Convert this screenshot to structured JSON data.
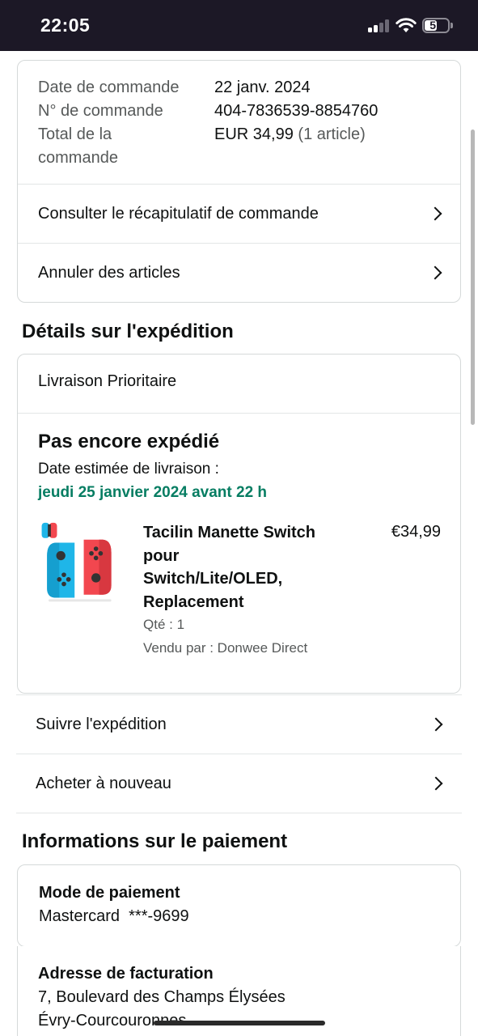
{
  "status_bar": {
    "time": "22:05",
    "battery": "51"
  },
  "order_summary": {
    "rows": [
      {
        "label": "Date de commande",
        "value": "22 janv. 2024"
      },
      {
        "label": "N° de commande",
        "value": "404-7836539-8854760"
      },
      {
        "label": "Total de la",
        "label_line2": "commande",
        "value": "EUR 34,99",
        "value_suffix": "(1 article)"
      }
    ],
    "links": [
      "Consulter le récapitulatif de commande",
      "Annuler des articles"
    ]
  },
  "shipment": {
    "section_title": "Détails sur l'expédition",
    "shipping_method": "Livraison Prioritaire",
    "status": "Pas encore expédié",
    "delivery_label": "Date estimée de livraison :",
    "delivery_date": "jeudi 25 janvier 2024 avant 22 h",
    "delivery_color": "#067d62",
    "item": {
      "title_lines": [
        "Tacilin Manette Switch",
        "pour",
        "Switch/Lite/OLED,",
        "Replacement"
      ],
      "price": "€34,99",
      "quantity": "Qté : 1",
      "seller": "Vendu par : Donwee Direct",
      "image_icon": "joy-con-controller-icon"
    },
    "links": [
      "Suivre l'expédition",
      "Acheter à nouveau"
    ]
  },
  "payment": {
    "section_title": "Informations sur le paiement",
    "method_label": "Mode de paiement",
    "method_value": "Mastercard  ***-9699",
    "billing_label": "Adresse de facturation",
    "billing_line1": "7, Boulevard des Champs Élysées",
    "billing_line2": "Évry-Courcouronnes"
  },
  "colors": {
    "status_bar_bg": "#1c1826",
    "joycon_blue": "#1fb6e8",
    "joycon_red": "#f2474f"
  }
}
